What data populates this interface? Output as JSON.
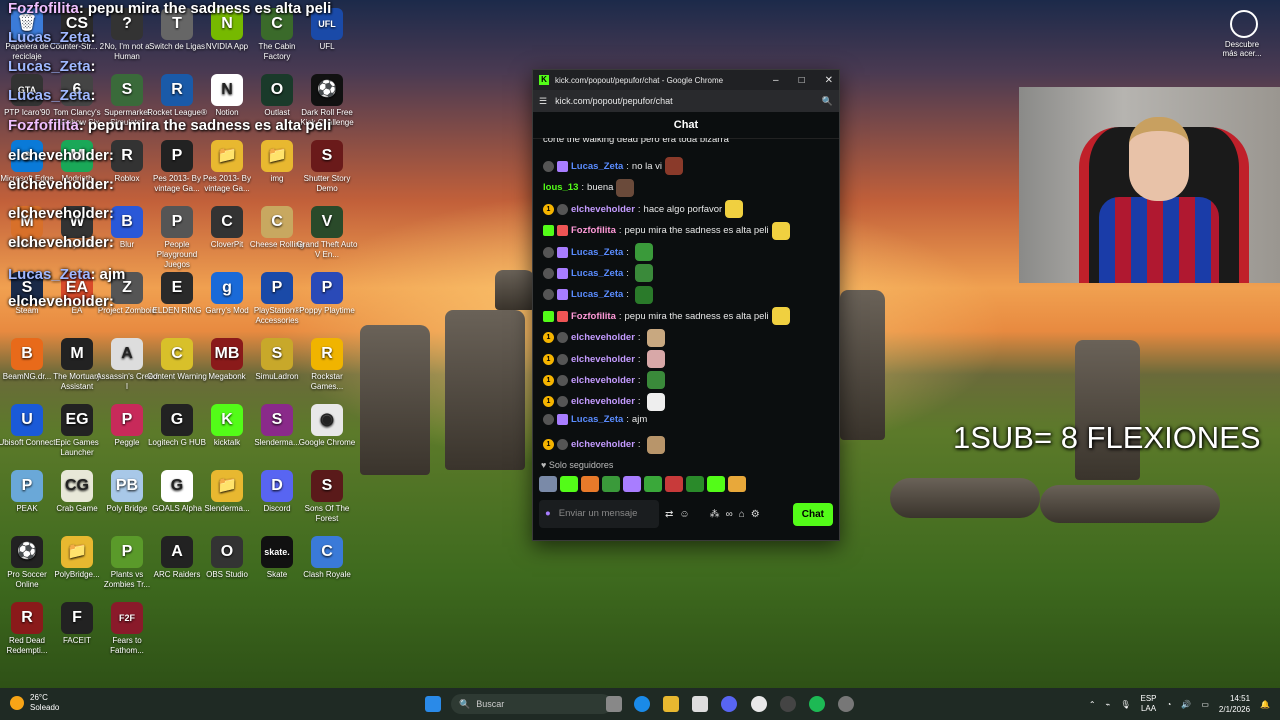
{
  "desktop": {
    "icons": [
      {
        "label": "Papelera de reciclaje",
        "color": "#3b7bd8",
        "glyph": "🗑"
      },
      {
        "label": "Counter-Str... 2",
        "color": "#2a2a2a",
        "glyph": "CS"
      },
      {
        "label": "No, I'm not a Human",
        "color": "#333",
        "glyph": "?"
      },
      {
        "label": "Switch de Ligas",
        "color": "#666",
        "glyph": "T"
      },
      {
        "label": "NVIDIA App",
        "color": "#76b900",
        "glyph": "N"
      },
      {
        "label": "The Cabin Factory",
        "color": "#3a6a2a",
        "glyph": "C"
      },
      {
        "label": "UFL",
        "color": "#1a4aa8",
        "glyph": "UFL"
      },
      {
        "label": "PTP Icaro'90",
        "color": "#333",
        "glyph": "GTA"
      },
      {
        "label": "Tom Clancy's Rainbow Six",
        "color": "#444",
        "glyph": "6"
      },
      {
        "label": "Supermarket Simulator",
        "color": "#3a6a3a",
        "glyph": "S"
      },
      {
        "label": "Rocket League®",
        "color": "#1a5aa8",
        "glyph": "R"
      },
      {
        "label": "Notion",
        "color": "#fff",
        "glyph": "N"
      },
      {
        "label": "Outlast",
        "color": "#1a3a2a",
        "glyph": "O"
      },
      {
        "label": "Dark Roll Free Kick Challenge",
        "color": "#111",
        "glyph": "⚽"
      },
      {
        "label": "Microsoft Edge",
        "color": "#0a7ad8",
        "glyph": "e"
      },
      {
        "label": "Modrinth",
        "color": "#1aa858",
        "glyph": "M"
      },
      {
        "label": "Roblox",
        "color": "#333",
        "glyph": "R"
      },
      {
        "label": "Pes 2013- By vintage Ga...",
        "color": "#222",
        "glyph": "P"
      },
      {
        "label": "Pes 2013- By vintage Ga...",
        "color": "#e8b830",
        "glyph": "📁"
      },
      {
        "label": "img",
        "color": "#e8b830",
        "glyph": "📁"
      },
      {
        "label": "Shutter Story Demo",
        "color": "#6a1a1a",
        "glyph": "S"
      },
      {
        "label": "Minecraft",
        "color": "#d8702a",
        "glyph": "M"
      },
      {
        "label": "Way Out",
        "color": "#333",
        "glyph": "W"
      },
      {
        "label": "Blur",
        "color": "#2a58d8",
        "glyph": "B"
      },
      {
        "label": "People Playground Juegos",
        "color": "#555",
        "glyph": "P"
      },
      {
        "label": "CloverPit",
        "color": "#333",
        "glyph": "C"
      },
      {
        "label": "Cheese Rolling",
        "color": "#c8a860",
        "glyph": "C"
      },
      {
        "label": "Grand Theft Auto V En...",
        "color": "#2a4a2a",
        "glyph": "V"
      },
      {
        "label": "Steam",
        "color": "#1a2a48",
        "glyph": "S"
      },
      {
        "label": "EA",
        "color": "#d84a2a",
        "glyph": "EA"
      },
      {
        "label": "Project Zomboid",
        "color": "#555",
        "glyph": "Z"
      },
      {
        "label": "ELDEN RING",
        "color": "#2a2a2a",
        "glyph": "E"
      },
      {
        "label": "Garry's Mod",
        "color": "#1a6ad8",
        "glyph": "g"
      },
      {
        "label": "PlayStation® Accessories",
        "color": "#1a4aa8",
        "glyph": "P"
      },
      {
        "label": "Poppy Playtime",
        "color": "#2a4ab8",
        "glyph": "P"
      },
      {
        "label": "BeamNG.dr...",
        "color": "#e86a1a",
        "glyph": "B"
      },
      {
        "label": "The Mortuary Assistant",
        "color": "#222",
        "glyph": "M"
      },
      {
        "label": "Assassin's Creed I",
        "color": "#ddd",
        "glyph": "A"
      },
      {
        "label": "Content Warning",
        "color": "#d8c02a",
        "glyph": "C"
      },
      {
        "label": "Megabonk",
        "color": "#8a1a1a",
        "glyph": "MB"
      },
      {
        "label": "SimuLadron",
        "color": "#c8a82a",
        "glyph": "S"
      },
      {
        "label": "Rockstar Games...",
        "color": "#f0b400",
        "glyph": "R"
      },
      {
        "label": "Ubisoft Connect",
        "color": "#1a5ad8",
        "glyph": "U"
      },
      {
        "label": "Epic Games Launcher",
        "color": "#222",
        "glyph": "EG"
      },
      {
        "label": "Peggle",
        "color": "#c82a5a",
        "glyph": "P"
      },
      {
        "label": "Logitech G HUB",
        "color": "#222",
        "glyph": "G"
      },
      {
        "label": "kicktalk",
        "color": "#53fc18",
        "glyph": "K"
      },
      {
        "label": "Slenderma...",
        "color": "#8a2a8a",
        "glyph": "S"
      },
      {
        "label": "Google Chrome",
        "color": "#e8e8e8",
        "glyph": "◉"
      },
      {
        "label": "PEAK",
        "color": "#6aa8d8",
        "glyph": "P"
      },
      {
        "label": "Crab Game",
        "color": "#e8e8d8",
        "glyph": "CG"
      },
      {
        "label": "Poly Bridge",
        "color": "#a8c8e8",
        "glyph": "PB"
      },
      {
        "label": "GOALS Alpha",
        "color": "#fff",
        "glyph": "G"
      },
      {
        "label": "Slenderma...",
        "color": "#e8b830",
        "glyph": "📁"
      },
      {
        "label": "Discord",
        "color": "#5865f2",
        "glyph": "D"
      },
      {
        "label": "Sons Of The Forest",
        "color": "#5a1a1a",
        "glyph": "S"
      },
      {
        "label": "Pro Soccer Online",
        "color": "#222",
        "glyph": "⚽"
      },
      {
        "label": "PolyBridge...",
        "color": "#e8b830",
        "glyph": "📁"
      },
      {
        "label": "Plants vs Zombies Tr...",
        "color": "#5a9a2a",
        "glyph": "P"
      },
      {
        "label": "ARC Raiders",
        "color": "#222",
        "glyph": "A"
      },
      {
        "label": "OBS Studio",
        "color": "#333",
        "glyph": "O"
      },
      {
        "label": "Skate",
        "color": "#111",
        "glyph": "skate."
      },
      {
        "label": "Clash Royale",
        "color": "#3a7ad8",
        "glyph": "C"
      },
      {
        "label": "Red Dead Redempti...",
        "color": "#8a1a1a",
        "glyph": "R"
      },
      {
        "label": "FACEIT",
        "color": "#222",
        "glyph": "F"
      },
      {
        "label": "Fears to Fathom...",
        "color": "#8a1a2a",
        "glyph": "F2F"
      }
    ],
    "right_icon": {
      "label": "Descubre más acer..."
    },
    "overlay_lines": [
      {
        "name": "Fozfofilita",
        "sep": ":",
        "text": "pepu mira the sadness es alta peli",
        "cls": "n1"
      },
      {
        "name": "Lucas_Zeta",
        "sep": ":",
        "text": "",
        "cls": "n2"
      },
      {
        "name": "Lucas_Zeta",
        "sep": ":",
        "text": "",
        "cls": "n2"
      },
      {
        "name": "Lucas_Zeta",
        "sep": ":",
        "text": "",
        "cls": "n2"
      },
      {
        "name": "Fozfofilita",
        "sep": ":",
        "text": "pepu mira the sadness es alta peli",
        "cls": "n1"
      },
      {
        "name": "elcheveholder",
        "sep": ":",
        "text": "",
        "cls": "n3"
      },
      {
        "name": "elcheveholder",
        "sep": ":",
        "text": "",
        "cls": "n3"
      },
      {
        "name": "elcheveholder",
        "sep": ":",
        "text": "",
        "cls": "n3"
      },
      {
        "name": "elcheveholder",
        "sep": ":",
        "text": "",
        "cls": "n3"
      },
      {
        "name": "Lucas_Zeta",
        "sep": ":",
        "text": "ajm",
        "cls": "n2"
      },
      {
        "name": "elcheveholder",
        "sep": ":",
        "text": "",
        "cls": "n3"
      }
    ],
    "stream_overlay": "1SUB= 8 FLEXIONES"
  },
  "window": {
    "title": "kick.com/popout/pepufor/chat - Google Chrome",
    "url": "kick.com/popout/pepufor/chat",
    "chat_header": "Chat",
    "messages": [
      {
        "partial": true,
        "text": "corte the walking dead pero era toda bizarra"
      },
      {
        "badges": [
          "grey",
          "purple"
        ],
        "name": "Lucas_Zeta",
        "color": "#5a8cff",
        "text": "no la vi",
        "emote": "#8a3a2a"
      },
      {
        "badges": [],
        "name": "lous_13",
        "color": "#53fc18",
        "text": "buena",
        "emote": "#6a4a3a"
      },
      {
        "badges": [
          "gold",
          "grey"
        ],
        "name": "elcheveholder",
        "color": "#c49bff",
        "text": "hace algo porfavor",
        "emote": "#f0d040"
      },
      {
        "badges": [
          "green",
          "fz"
        ],
        "name": "Fozfofilita",
        "color": "#ff9ad8",
        "text": "pepu mira the sadness es alta peli",
        "emote": "#f0d040"
      },
      {
        "badges": [
          "grey",
          "purple"
        ],
        "name": "Lucas_Zeta",
        "color": "#5a8cff",
        "text": "",
        "emote": "#3a9a3a"
      },
      {
        "badges": [
          "grey",
          "purple"
        ],
        "name": "Lucas_Zeta",
        "color": "#5a8cff",
        "text": "",
        "emote": "#3a8a3a"
      },
      {
        "badges": [
          "grey",
          "purple"
        ],
        "name": "Lucas_Zeta",
        "color": "#5a8cff",
        "text": "",
        "emote": "#2a7a2a"
      },
      {
        "badges": [
          "green",
          "fz"
        ],
        "name": "Fozfofilita",
        "color": "#ff9ad8",
        "text": "pepu mira the sadness es alta peli",
        "emote": "#f0d040"
      },
      {
        "badges": [
          "gold",
          "grey"
        ],
        "name": "elcheveholder",
        "color": "#c49bff",
        "text": "",
        "emote": "#c8a880"
      },
      {
        "badges": [
          "gold",
          "grey"
        ],
        "name": "elcheveholder",
        "color": "#c49bff",
        "text": "",
        "emote": "#d8a8a8"
      },
      {
        "badges": [
          "gold",
          "grey"
        ],
        "name": "elcheveholder",
        "color": "#c49bff",
        "text": "",
        "emote": "#3a8a3a"
      },
      {
        "badges": [
          "gold",
          "grey"
        ],
        "name": "elcheveholder",
        "color": "#c49bff",
        "text": "",
        "emote": "#eeeeee"
      },
      {
        "badges": [
          "grey",
          "purple"
        ],
        "name": "Lucas_Zeta",
        "color": "#5a8cff",
        "text": "ajm",
        "emote": ""
      },
      {
        "badges": [
          "gold",
          "grey"
        ],
        "name": "elcheveholder",
        "color": "#c49bff",
        "text": "",
        "emote": "#b8956a"
      }
    ],
    "followers_only": "Solo seguidores",
    "input_placeholder": "Enviar un mensaje",
    "send_label": "Chat"
  },
  "taskbar": {
    "temp": "26°C",
    "weather": "Soleado",
    "search_placeholder": "Buscar",
    "lang": "ESP",
    "lang2": "LAA",
    "time": "14:51",
    "date": "2/1/2026"
  },
  "colors": {
    "kick_green": "#53fc18"
  }
}
